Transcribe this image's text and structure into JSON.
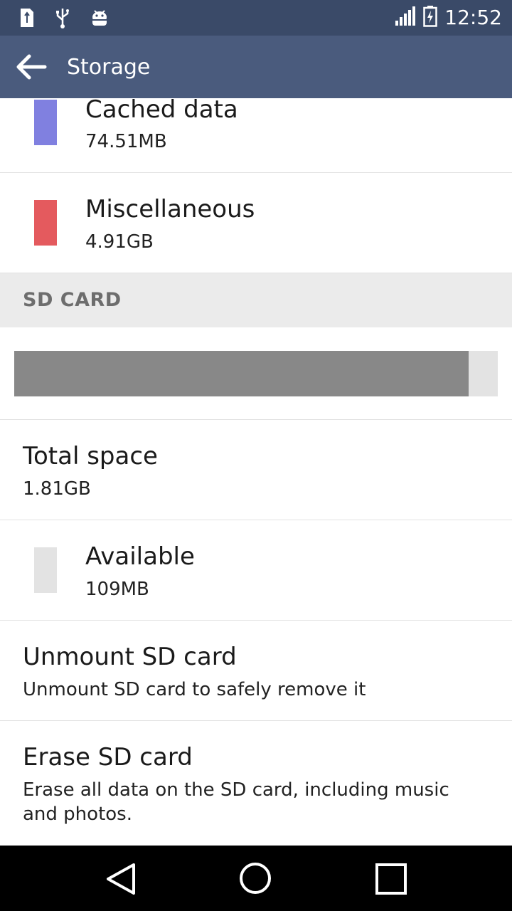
{
  "status_bar": {
    "time": "12:52",
    "left_icons": [
      "sd-card-icon",
      "usb-icon",
      "android-debug-icon"
    ],
    "right_icons": [
      "signal-icon",
      "battery-charging-icon"
    ]
  },
  "app_bar": {
    "title": "Storage"
  },
  "internal_items": [
    {
      "label": "Cached data",
      "value": "74.51MB",
      "color": "#8080e0"
    },
    {
      "label": "Miscellaneous",
      "value": "4.91GB",
      "color": "#e45a5e"
    }
  ],
  "sd_card": {
    "section_title": "SD CARD",
    "used_fraction": 0.94,
    "bar_used_color": "#888888",
    "bar_free_color": "#e3e3e3",
    "total": {
      "label": "Total space",
      "value": "1.81GB"
    },
    "available": {
      "label": "Available",
      "value": "109MB",
      "color": "#e3e3e3"
    },
    "unmount": {
      "label": "Unmount SD card",
      "description": "Unmount SD card to safely remove it"
    },
    "erase": {
      "label": "Erase SD card",
      "description": "Erase all data on the SD card, including music and photos."
    }
  },
  "nav_bar": {
    "icons": [
      "back-triangle-icon",
      "home-circle-icon",
      "recents-square-icon"
    ]
  }
}
